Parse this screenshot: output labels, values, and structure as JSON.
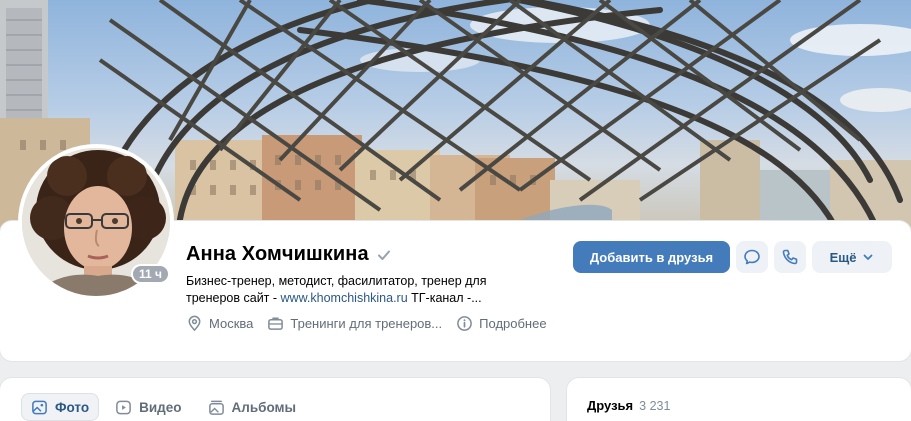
{
  "profile": {
    "name": "Анна Хомчишкина",
    "online_badge": "11 ч",
    "bio_text": "Бизнес-тренер, методист, фасилитатор, тренер для тренеров сайт - ",
    "bio_link": "www.khomchishkina.ru",
    "bio_tail": " ТГ-канал -...",
    "city": "Москва",
    "work": "Тренинги для тренеров...",
    "more_info": "Подробнее"
  },
  "actions": {
    "add_friend": "Добавить в друзья",
    "more": "Ещё"
  },
  "media_tabs": [
    {
      "label": "Фото",
      "icon": "photo-icon",
      "active": true
    },
    {
      "label": "Видео",
      "icon": "video-icon",
      "active": false
    },
    {
      "label": "Альбомы",
      "icon": "album-icon",
      "active": false
    }
  ],
  "friends": {
    "label": "Друзья",
    "count": "3 231"
  },
  "colors": {
    "primary_button": "#447bba",
    "link": "#2a5885",
    "secondary_text": "#626d7a",
    "background": "#edeef0"
  }
}
